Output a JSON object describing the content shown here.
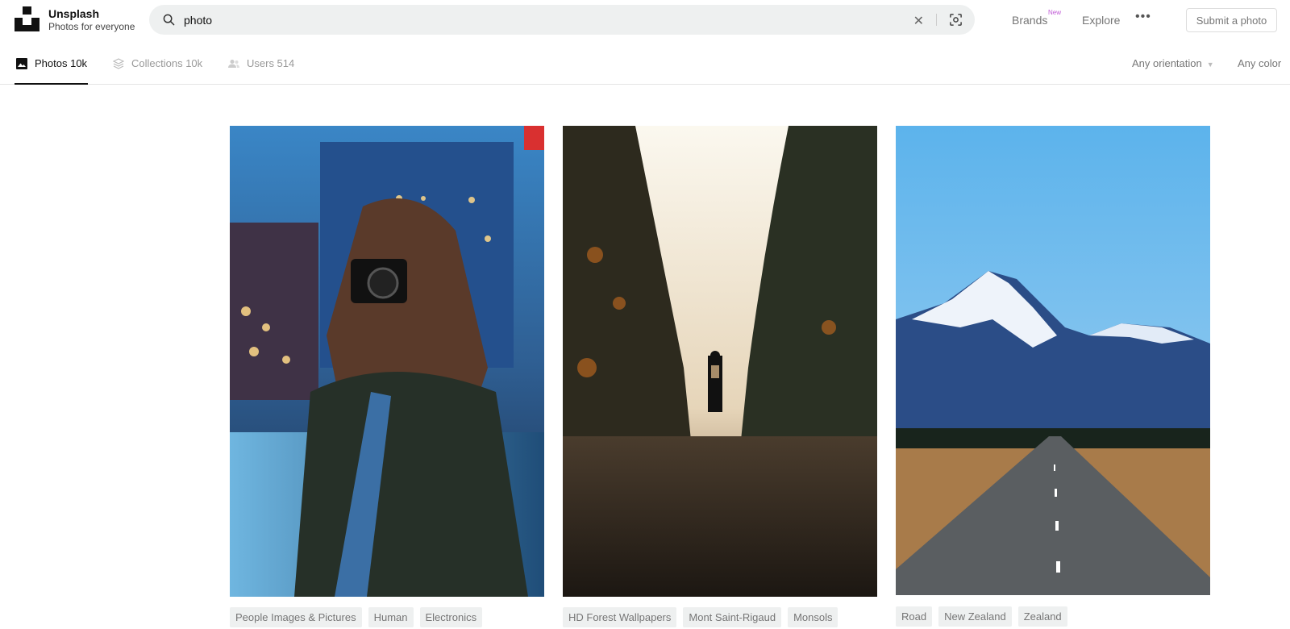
{
  "header": {
    "brand_name": "Unsplash",
    "brand_tagline": "Photos for everyone",
    "search": {
      "value": "photo"
    },
    "nav": {
      "brands": "Brands",
      "brands_badge": "New",
      "explore": "Explore",
      "more": "•••"
    },
    "submit_label": "Submit a photo"
  },
  "tabs": [
    {
      "label": "Photos 10k",
      "icon": "image-icon",
      "active": true
    },
    {
      "label": "Collections 10k",
      "icon": "collections-icon",
      "active": false
    },
    {
      "label": "Users 514",
      "icon": "users-icon",
      "active": false
    }
  ],
  "filters": {
    "orientation": "Any orientation",
    "color": "Any color"
  },
  "photos": [
    {
      "subject": "Woman taking a photo with a camera in a city at dusk",
      "tags": [
        "People Images & Pictures",
        "Human",
        "Electronics"
      ]
    },
    {
      "subject": "Person with backpack standing on a forest road in fog",
      "tags": [
        "HD Forest Wallpapers",
        "Mont Saint-Rigaud",
        "Monsols"
      ]
    },
    {
      "subject": "Road leading to a snowy mountain under blue sky",
      "tags": [
        "Road",
        "New Zealand",
        "Zealand"
      ]
    }
  ]
}
